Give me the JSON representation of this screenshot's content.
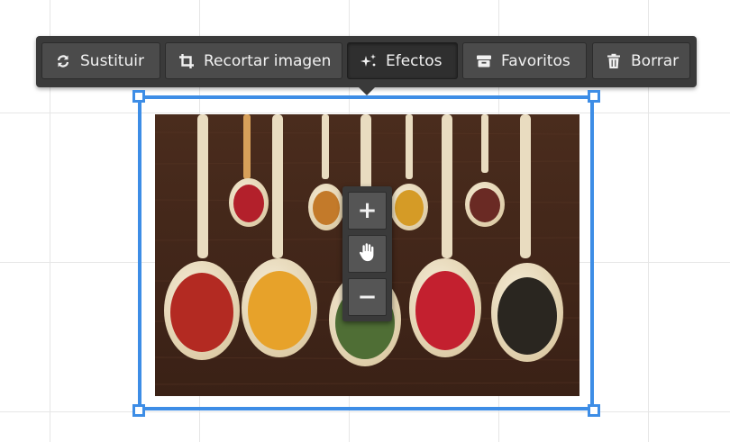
{
  "toolbar": {
    "buttons": [
      {
        "id": "replace",
        "label": "Sustituir",
        "icon": "refresh-icon"
      },
      {
        "id": "crop",
        "label": "Recortar imagen",
        "icon": "crop-icon"
      },
      {
        "id": "effects",
        "label": "Efectos",
        "icon": "sparkle-icon",
        "active": true
      },
      {
        "id": "favorites",
        "label": "Favoritos",
        "icon": "archive-icon"
      },
      {
        "id": "delete",
        "label": "Borrar",
        "icon": "trash-icon"
      }
    ]
  },
  "zoom_controls": {
    "zoom_in": "+",
    "pan": "hand-pan-icon",
    "zoom_out": "−"
  },
  "colors": {
    "selection": "#3d8de6",
    "toolbar_bg": "#3a3a3a",
    "button_bg": "#4b4b4b",
    "button_active_bg": "#2f2f2f"
  }
}
